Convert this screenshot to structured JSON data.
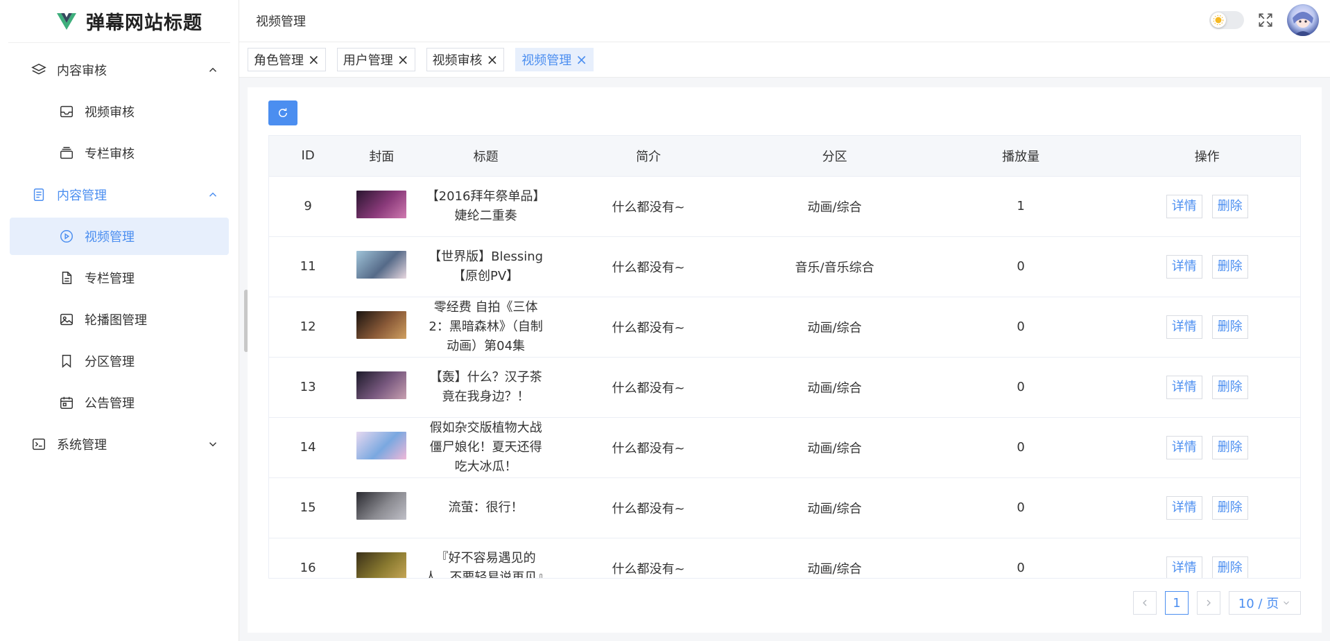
{
  "app": {
    "title": "弹幕网站标题"
  },
  "sidebar": {
    "groups": [
      {
        "label": "内容审核",
        "icon": "layers-icon",
        "expanded": true,
        "items": [
          {
            "label": "视频审核",
            "icon": "inbox-icon"
          },
          {
            "label": "专栏审核",
            "icon": "stack-icon"
          }
        ]
      },
      {
        "label": "内容管理",
        "icon": "document-icon",
        "expanded": true,
        "items": [
          {
            "label": "视频管理",
            "icon": "play-circle-icon",
            "active": true
          },
          {
            "label": "专栏管理",
            "icon": "file-text-icon"
          },
          {
            "label": "轮播图管理",
            "icon": "image-icon"
          },
          {
            "label": "分区管理",
            "icon": "bookmark-icon"
          },
          {
            "label": "公告管理",
            "icon": "calendar-icon"
          }
        ]
      },
      {
        "label": "系统管理",
        "icon": "terminal-icon",
        "expanded": false
      }
    ]
  },
  "header": {
    "title": "视频管理"
  },
  "tabs": [
    {
      "label": "角色管理",
      "active": false
    },
    {
      "label": "用户管理",
      "active": false
    },
    {
      "label": "视频审核",
      "active": false
    },
    {
      "label": "视频管理",
      "active": true
    }
  ],
  "table": {
    "columns": [
      "ID",
      "封面",
      "标题",
      "简介",
      "分区",
      "播放量",
      "操作"
    ],
    "detail_label": "详情",
    "delete_label": "删除",
    "rows": [
      {
        "id": "9",
        "title": "【2016拜年祭单品】婕纶二重奏",
        "desc": "什么都没有~",
        "zone": "动画/综合",
        "plays": "1",
        "cover": [
          "#2a1530",
          "#8a3a7a",
          "#d07ab0"
        ]
      },
      {
        "id": "11",
        "title": "【世界版】Blessing【原创PV】",
        "desc": "什么都没有~",
        "zone": "音乐/音乐综合",
        "plays": "0",
        "cover": [
          "#9fc3d8",
          "#556a88",
          "#e8d8e0"
        ]
      },
      {
        "id": "12",
        "title": "零经费 自拍《三体2：黑暗森林》（自制动画）第04集",
        "desc": "什么都没有~",
        "zone": "动画/综合",
        "plays": "0",
        "cover": [
          "#1a1410",
          "#8a5a38",
          "#d0a060"
        ]
      },
      {
        "id": "13",
        "title": "【轰】什么？汉子茶竟在我身边？！",
        "desc": "什么都没有~",
        "zone": "动画/综合",
        "plays": "0",
        "cover": [
          "#1c1a2a",
          "#7a5a80",
          "#c8a0b0"
        ]
      },
      {
        "id": "14",
        "title": "假如杂交版植物大战僵尸娘化！夏天还得吃大冰瓜！",
        "desc": "什么都没有~",
        "zone": "动画/综合",
        "plays": "0",
        "cover": [
          "#e6d8f0",
          "#7aa8e0",
          "#f0b8d8"
        ]
      },
      {
        "id": "15",
        "title": "流萤：很行！",
        "desc": "什么都没有~",
        "zone": "动画/综合",
        "plays": "0",
        "cover": [
          "#2a2a30",
          "#8a8a90",
          "#c0c0c8"
        ]
      },
      {
        "id": "16",
        "title": "『好不容易遇见的人，不要轻易说再见』",
        "desc": "什么都没有~",
        "zone": "动画/综合",
        "plays": "0",
        "cover": [
          "#3a3018",
          "#8a7a30",
          "#c8a858"
        ]
      }
    ]
  },
  "pager": {
    "current": "1",
    "page_size": "10 / 页"
  },
  "colors": {
    "accent": "#4b8ef0",
    "logo": "#3eaf7c"
  }
}
